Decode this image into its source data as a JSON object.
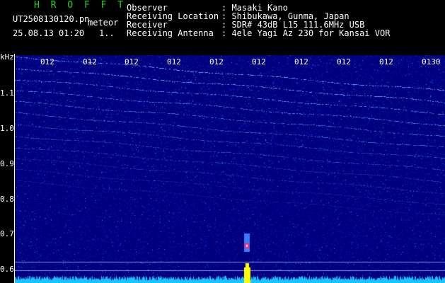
{
  "header": {
    "program": "H R O F F T",
    "filename": "UT2508130120.pn",
    "tag": "meteor",
    "datetime": "25.08.13 01:20",
    "page": "1..",
    "fields": [
      {
        "label": "Observer",
        "value": ": Masaki Kano"
      },
      {
        "label": "Receiving Location",
        "value": ": Shibukawa, Gunma, Japan"
      },
      {
        "label": "Receiver",
        "value": ": SDR# 43dB L15 111.6MHz USB"
      },
      {
        "label": "Receiving Antenna",
        "value": ": 4ele Yagi Az 230 for Kansai VOR"
      }
    ]
  },
  "axis": {
    "unit": "kHz",
    "y_ticks": [
      "1.1",
      "1.0",
      "0.9",
      "0.8",
      "0.7",
      "0.6"
    ],
    "x_ticks": [
      "012",
      "012",
      "012",
      "012",
      "012",
      "012",
      "012",
      "012",
      "012",
      "0130"
    ]
  },
  "colors": {
    "background": "#000000",
    "spectrum_bg": "#00007f",
    "program": "#22d11c",
    "meteor": "#ff2a6a",
    "carrier": "#ffff00",
    "noise_floor": "#19c3ff"
  }
}
